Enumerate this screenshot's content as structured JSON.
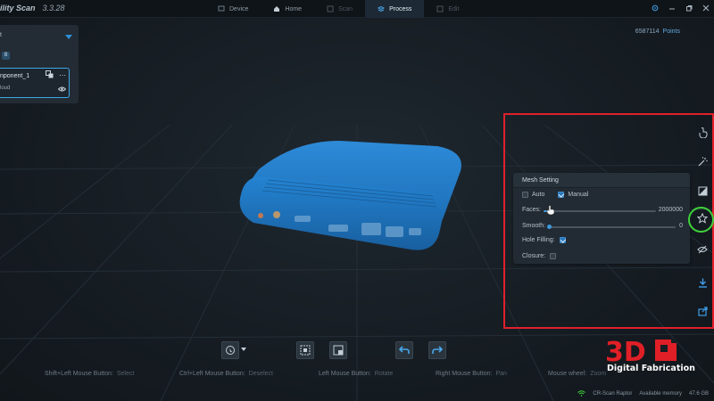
{
  "app": {
    "title": "ility Scan",
    "version": "3.3.28"
  },
  "tabs": [
    {
      "label": "Device",
      "icon": "device-icon",
      "state": "normal"
    },
    {
      "label": "Home",
      "icon": "home-icon",
      "state": "normal"
    },
    {
      "label": "Scan",
      "icon": "scan-icon",
      "state": "disabled"
    },
    {
      "label": "Process",
      "icon": "process-icon",
      "state": "active"
    },
    {
      "label": "Edit",
      "icon": "edit-icon",
      "state": "disabled"
    }
  ],
  "window_controls": [
    "settings-icon",
    "minimize-icon",
    "maximize-icon",
    "close-icon"
  ],
  "component_panel": {
    "select_value": "t",
    "tag": "8",
    "item": {
      "name": "nponent_1",
      "type": "loud"
    }
  },
  "points_readout": {
    "value": "6587114",
    "label": "Points"
  },
  "mesh_setting": {
    "title": "Mesh Setting",
    "auto_label": "Auto",
    "auto_checked": false,
    "manual_label": "Manual",
    "manual_checked": true,
    "faces_label": "Faces:",
    "faces_value": "2000000",
    "faces_fraction": 0.04,
    "smooth_label": "Smooth:",
    "smooth_value": "0",
    "smooth_fraction": 0.0,
    "hole_filling_label": "Hole Filling:",
    "hole_filling_checked": true,
    "closure_label": "Closure:",
    "closure_checked": false
  },
  "right_tools": [
    "touch-icon",
    "magic-wand-icon",
    "crop-icon",
    "mesh-star-icon",
    "eye-slash-icon",
    "download-icon",
    "share-icon"
  ],
  "bottom_tools": [
    "select-mode-icon",
    "select-area-icon",
    "deselect-area-icon",
    "undo-icon",
    "redo-icon"
  ],
  "hints": [
    {
      "key": "Shift+Left Mouse Button:",
      "action": "Select"
    },
    {
      "key": "Ctrl+Left Mouse Button:",
      "action": "Deselect"
    },
    {
      "key": "Left Mouse Button:",
      "action": "Rotate"
    },
    {
      "key": "Right Mouse Button:",
      "action": "Pan"
    },
    {
      "key": "Mouse wheel:",
      "action": "Zoom"
    }
  ],
  "status": {
    "device": "CR-Scan Raptor",
    "memory_label": "Available memory",
    "memory_value": "47.6 GB"
  },
  "watermark": {
    "brand": "3D",
    "subtitle": "Digital Fabrication"
  },
  "colors": {
    "accent": "#2f8fd6",
    "highlight_red": "#e0202c",
    "highlight_green": "#3fd23c",
    "model": "#1f78c8"
  }
}
